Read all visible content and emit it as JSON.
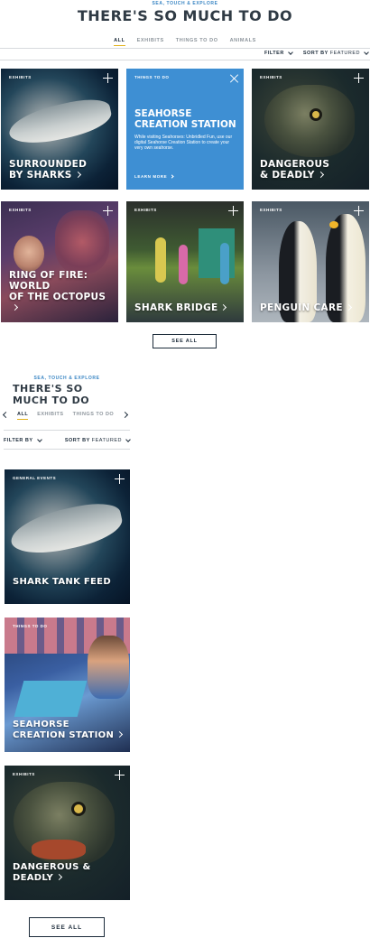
{
  "desktop": {
    "eyebrow": "SEA, TOUCH & EXPLORE",
    "title": "THERE'S SO MUCH TO DO",
    "tabs": [
      "ALL",
      "EXHIBITS",
      "THINGS TO DO",
      "ANIMALS"
    ],
    "filter_label": "FILTER",
    "sort_label": "SORT BY",
    "sort_value": "FEATURED",
    "cards": [
      {
        "category": "EXHIBITS",
        "title_line1": "SURROUNDED",
        "title_line2": "BY SHARKS"
      },
      {
        "category": "THINGS TO DO",
        "title_line1": "SEAHORSE",
        "title_line2": "CREATION STATION",
        "description": "While visiting Seahorses: Unbridled Fun, use our digital Seahorse Creation Station to create your very own seahorse.",
        "link": "LEARN MORE"
      },
      {
        "category": "EXHIBITS",
        "title_line1": "DANGEROUS",
        "title_line2": "& DEADLY"
      },
      {
        "category": "EXHIBITS",
        "title_line1": "RING OF FIRE: WORLD",
        "title_line2": "OF THE OCTOPUS"
      },
      {
        "category": "EXHIBITS",
        "title_line1": "SHARK BRIDGE",
        "title_line2": ""
      },
      {
        "category": "EXHIBITS",
        "title_line1": "PENGUIN CARE",
        "title_line2": ""
      }
    ],
    "see_all": "SEE ALL"
  },
  "mobile": {
    "eyebrow": "SEA, TOUCH & EXPLORE",
    "title": "THERE'S SO MUCH TO DO",
    "tabs": [
      "ALL",
      "EXHIBITS",
      "THINGS TO DO"
    ],
    "filter_label": "FILTER BY",
    "sort_label": "SORT BY",
    "sort_value": "FEATURED",
    "cards": [
      {
        "category": "GENERAL EVENTS",
        "title_line1": "SHARK TANK FEED",
        "title_line2": ""
      },
      {
        "category": "THINGS TO DO",
        "title_line1": "SEAHORSE",
        "title_line2": "CREATION STATION"
      },
      {
        "category": "EXHIBITS",
        "title_line1": "DANGEROUS & DEADLY",
        "title_line2": ""
      }
    ],
    "see_all": "SEE ALL"
  },
  "colors": {
    "accent_underline": "#e2b21c",
    "eyebrow_blue": "#3a86c4",
    "card_blue": "#3e8fd3"
  }
}
